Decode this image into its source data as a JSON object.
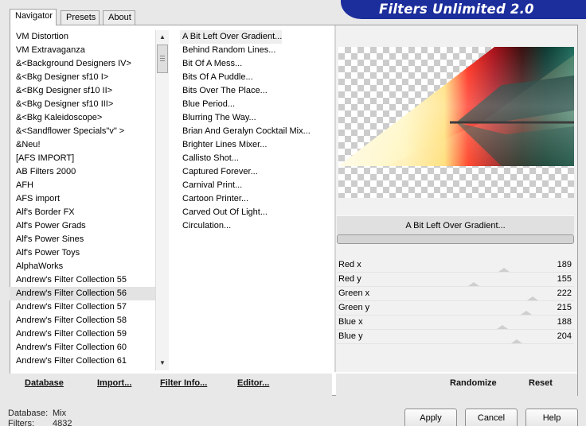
{
  "tabs": [
    {
      "label": "Navigator",
      "active": true
    },
    {
      "label": "Presets",
      "active": false
    },
    {
      "label": "About",
      "active": false
    }
  ],
  "banner": {
    "title": "Filters Unlimited 2.0"
  },
  "categories": [
    {
      "label": "VM Distortion"
    },
    {
      "label": "VM Extravaganza"
    },
    {
      "label": "&<Background Designers IV>"
    },
    {
      "label": "&<Bkg Designer sf10 I>"
    },
    {
      "label": "&<BKg Designer sf10 II>"
    },
    {
      "label": "&<Bkg Designer sf10 III>"
    },
    {
      "label": "&<Bkg Kaleidoscope>"
    },
    {
      "label": "&<Sandflower Specials\"v\" >"
    },
    {
      "label": "&Neu!"
    },
    {
      "label": "[AFS IMPORT]"
    },
    {
      "label": "AB Filters 2000"
    },
    {
      "label": "AFH"
    },
    {
      "label": "AFS import"
    },
    {
      "label": "Alf's Border FX"
    },
    {
      "label": "Alf's Power Grads"
    },
    {
      "label": "Alf's Power Sines"
    },
    {
      "label": "Alf's Power Toys"
    },
    {
      "label": "AlphaWorks"
    },
    {
      "label": "Andrew's Filter Collection 55"
    },
    {
      "label": "Andrew's Filter Collection 56",
      "selected": true
    },
    {
      "label": "Andrew's Filter Collection 57"
    },
    {
      "label": "Andrew's Filter Collection 58"
    },
    {
      "label": "Andrew's Filter Collection 59"
    },
    {
      "label": "Andrew's Filter Collection 60"
    },
    {
      "label": "Andrew's Filter Collection 61"
    }
  ],
  "filters": [
    {
      "label": "A Bit Left Over Gradient...",
      "selected": true
    },
    {
      "label": "Behind Random Lines..."
    },
    {
      "label": "Bit Of A Mess..."
    },
    {
      "label": "Bits Of A Puddle..."
    },
    {
      "label": "Bits Over The Place..."
    },
    {
      "label": "Blue Period..."
    },
    {
      "label": "Blurring The Way..."
    },
    {
      "label": "Brian And Geralyn Cocktail Mix..."
    },
    {
      "label": "Brighter Lines Mixer..."
    },
    {
      "label": "Callisto Shot..."
    },
    {
      "label": "Captured Forever..."
    },
    {
      "label": "Carnival Print..."
    },
    {
      "label": "Cartoon Printer..."
    },
    {
      "label": "Carved Out Of Light..."
    },
    {
      "label": "Circulation..."
    }
  ],
  "selected_filter": "A Bit Left Over Gradient...",
  "params": [
    {
      "label": "Red x",
      "value": "189",
      "level": 189
    },
    {
      "label": "Red y",
      "value": "155",
      "level": 155
    },
    {
      "label": "Green x",
      "value": "222",
      "level": 222
    },
    {
      "label": "Green y",
      "value": "215",
      "level": 215
    },
    {
      "label": "Blue x",
      "value": "188",
      "level": 188
    },
    {
      "label": "Blue y",
      "value": "204",
      "level": 204
    }
  ],
  "toolbar": {
    "database": "Database",
    "import": "Import...",
    "filter_info": "Filter Info...",
    "editor": "Editor...",
    "randomize": "Randomize",
    "reset": "Reset"
  },
  "status": {
    "database_label": "Database:",
    "database_value": "Mix",
    "filters_label": "Filters:",
    "filters_value": "4832"
  },
  "buttons": {
    "apply": "Apply",
    "cancel": "Cancel",
    "help": "Help"
  },
  "colors": {
    "banner": "#1c2d9c",
    "panel": "#ffffff",
    "background": "#e8e8e8"
  }
}
